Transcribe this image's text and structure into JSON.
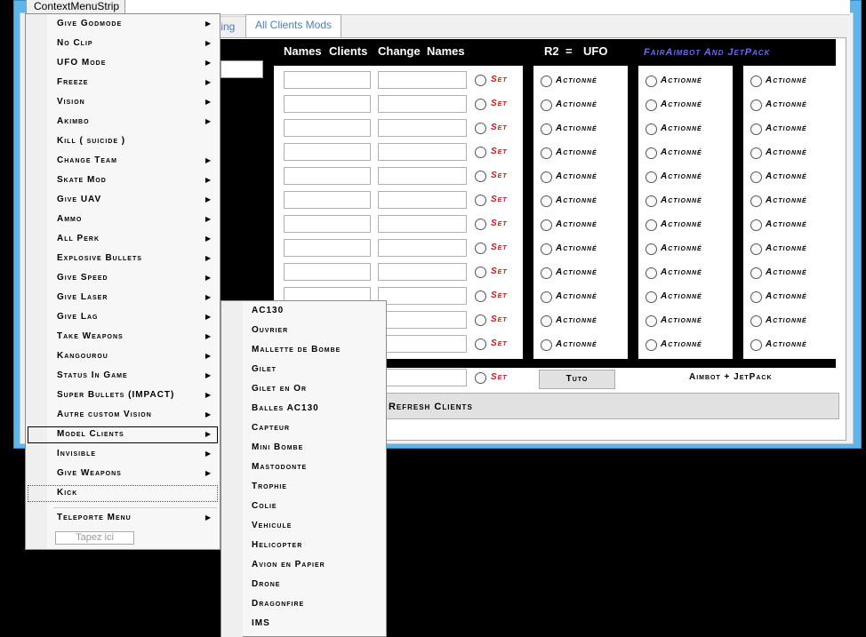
{
  "context_menu": {
    "title": "ContextMenuStrip",
    "items": [
      {
        "label": "Give Godmode",
        "submenu": true
      },
      {
        "label": "No Clip",
        "submenu": true
      },
      {
        "label": "UFO Mode",
        "submenu": true
      },
      {
        "label": "Freeze",
        "submenu": true
      },
      {
        "label": "Vision",
        "submenu": true
      },
      {
        "label": "Akimbo",
        "submenu": true
      },
      {
        "label": "Kill ( suicide )",
        "submenu": false
      },
      {
        "label": "Change Team",
        "submenu": true
      },
      {
        "label": "Skate Mod",
        "submenu": true
      },
      {
        "label": "Give UAV",
        "submenu": true
      },
      {
        "label": "Ammo",
        "submenu": true
      },
      {
        "label": "All Perk",
        "submenu": true
      },
      {
        "label": "Explosive Bullets",
        "submenu": true
      },
      {
        "label": "Give Speed",
        "submenu": true
      },
      {
        "label": "Give Laser",
        "submenu": true
      },
      {
        "label": "Give Lag",
        "submenu": true
      },
      {
        "label": "Take Weapons",
        "submenu": true
      },
      {
        "label": "Kangourou",
        "submenu": true
      },
      {
        "label": "Status In Game",
        "submenu": true
      },
      {
        "label": "Super Bullets (IMPACT)",
        "submenu": true
      },
      {
        "label": "Autre custom Vision",
        "submenu": true
      },
      {
        "label": "Model Clients",
        "submenu": true
      },
      {
        "label": "Invisible",
        "submenu": true
      },
      {
        "label": "Give Weapons",
        "submenu": true
      },
      {
        "label": "Kick",
        "submenu": false
      },
      {
        "label": "Teleporte Menu",
        "submenu": true
      }
    ],
    "input_placeholder": "Tapez ici"
  },
  "submenu": {
    "items": [
      "AC130",
      "Ouvrier",
      "Mallette de Bombe",
      "Gilet",
      "Gilet en Or",
      "Balles AC130",
      "Capteur",
      "Mini Bombe",
      "Mastodonte",
      "Trophie",
      "Colie",
      "Vehicule",
      "Helicopter",
      "Avion en Papier",
      "Drone",
      "Dragonfire",
      "IMS"
    ]
  },
  "tabs": {
    "partial": "ting",
    "active": "All Clients Mods"
  },
  "grid": {
    "headers": {
      "names": "Names",
      "clients": "Clients",
      "change": "Change",
      "names2": "Names",
      "r2": "R2",
      "eq": "=",
      "ufo": "UFO",
      "fair": "FairAimbot And JetPack"
    },
    "set_label": "Set",
    "action_label": "Actionné",
    "row_count": 12
  },
  "buttons": {
    "tuto": "Tuto",
    "aimbot": "Aimbot + JetPack",
    "refresh": "t Refresh Clients"
  },
  "colors": {
    "accent_blue": "#5fb4e8",
    "set_red": "#d01818",
    "fair_purple": "#6a6aff"
  }
}
